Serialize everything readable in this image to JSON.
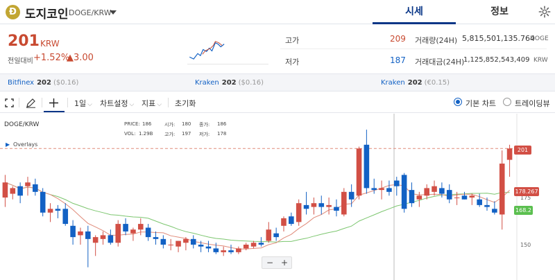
{
  "header": {
    "logo_letter": "Ð",
    "name": "도지코인",
    "code": "DOGE/KRW",
    "tabs": [
      "시세",
      "정보"
    ]
  },
  "summary": {
    "price": "201",
    "unit": "KRW",
    "change_label": "전일대비",
    "change_pct": "+1.52%",
    "change_abs": "▲3.00",
    "high_label": "고가",
    "high_value": "209",
    "low_label": "저가",
    "low_value": "187",
    "volume_label": "거래량(24H)",
    "volume_value": "5,815,501,135.764",
    "volume_unit": "DOGE",
    "amount_label": "거래대금(24H)",
    "amount_value": "1,125,852,543,409",
    "amount_unit": "KRW"
  },
  "exchanges": [
    {
      "name": "Bitfinex",
      "price": "202",
      "conv": "($0.16)"
    },
    {
      "name": "Kraken",
      "price": "202",
      "conv": "($0.16)"
    },
    {
      "name": "Kraken",
      "price": "202",
      "conv": "(€0.15)"
    }
  ],
  "toolbar": {
    "interval": "1일",
    "chart_settings": "차트설정",
    "indicators": "지표",
    "reset": "초기화",
    "basic_chart": "기본 차트",
    "tradingview": "트레이딩뷰"
  },
  "chart": {
    "symbol": "DOGE/KRW",
    "overlays_label": "Overlays",
    "info": {
      "price_label": "PRICE:",
      "price": "186",
      "open_label": "시가:",
      "open": "180",
      "close_label": "종가:",
      "close": "186",
      "vol_label": "VOL:",
      "vol": "1.29B",
      "high_label": "고가:",
      "high": "197",
      "low_label": "저가:",
      "low": "178"
    },
    "price_tag": "201",
    "ma1_tag": "178.267",
    "ma2_tag": "168.2",
    "axis_ticks": [
      "175",
      "150"
    ],
    "zoom_out": "−",
    "zoom_in": "+",
    "colors": {
      "up": "#d24f45",
      "down": "#1261c4",
      "ma_short": "#e08b7a",
      "ma_long": "#7cc66f"
    }
  },
  "chart_data": {
    "type": "candlestick",
    "title": "DOGE/KRW",
    "ylabel": "",
    "y_ticks": [
      175,
      150
    ],
    "candles": [
      {
        "o": 175,
        "h": 187,
        "l": 170,
        "c": 183
      },
      {
        "o": 177,
        "h": 181,
        "l": 174,
        "c": 180
      },
      {
        "o": 181,
        "h": 183,
        "l": 172,
        "c": 176
      },
      {
        "o": 181,
        "h": 186,
        "l": 176,
        "c": 183
      },
      {
        "o": 182,
        "h": 185,
        "l": 176,
        "c": 178
      },
      {
        "o": 178,
        "h": 180,
        "l": 165,
        "c": 167
      },
      {
        "o": 167,
        "h": 172,
        "l": 162,
        "c": 169
      },
      {
        "o": 169,
        "h": 171,
        "l": 164,
        "c": 168
      },
      {
        "o": 169,
        "h": 172,
        "l": 160,
        "c": 161
      },
      {
        "o": 160,
        "h": 163,
        "l": 150,
        "c": 154
      },
      {
        "o": 155,
        "h": 159,
        "l": 150,
        "c": 157
      },
      {
        "o": 157,
        "h": 160,
        "l": 138,
        "c": 153
      },
      {
        "o": 151,
        "h": 155,
        "l": 144,
        "c": 154
      },
      {
        "o": 153,
        "h": 157,
        "l": 150,
        "c": 155
      },
      {
        "o": 155,
        "h": 158,
        "l": 150,
        "c": 151
      },
      {
        "o": 151,
        "h": 163,
        "l": 149,
        "c": 161
      },
      {
        "o": 161,
        "h": 164,
        "l": 155,
        "c": 157
      },
      {
        "o": 156,
        "h": 159,
        "l": 152,
        "c": 158
      },
      {
        "o": 158,
        "h": 164,
        "l": 155,
        "c": 161
      },
      {
        "o": 159,
        "h": 161,
        "l": 152,
        "c": 154
      },
      {
        "o": 154,
        "h": 157,
        "l": 150,
        "c": 153
      },
      {
        "o": 153,
        "h": 155,
        "l": 148,
        "c": 150
      },
      {
        "o": 150,
        "h": 153,
        "l": 147,
        "c": 150
      },
      {
        "o": 149,
        "h": 152,
        "l": 146,
        "c": 152
      },
      {
        "o": 151,
        "h": 154,
        "l": 147,
        "c": 153
      },
      {
        "o": 153,
        "h": 155,
        "l": 148,
        "c": 150
      },
      {
        "o": 150,
        "h": 152,
        "l": 146,
        "c": 149
      },
      {
        "o": 149,
        "h": 152,
        "l": 146,
        "c": 148
      },
      {
        "o": 148,
        "h": 151,
        "l": 145,
        "c": 146
      },
      {
        "o": 146,
        "h": 149,
        "l": 144,
        "c": 147
      },
      {
        "o": 147,
        "h": 150,
        "l": 145,
        "c": 146
      },
      {
        "o": 146,
        "h": 149,
        "l": 145,
        "c": 148
      },
      {
        "o": 148,
        "h": 151,
        "l": 147,
        "c": 150
      },
      {
        "o": 149,
        "h": 152,
        "l": 148,
        "c": 151
      },
      {
        "o": 151,
        "h": 154,
        "l": 149,
        "c": 150
      },
      {
        "o": 152,
        "h": 162,
        "l": 151,
        "c": 158
      },
      {
        "o": 156,
        "h": 159,
        "l": 152,
        "c": 154
      },
      {
        "o": 160,
        "h": 165,
        "l": 157,
        "c": 164
      },
      {
        "o": 165,
        "h": 167,
        "l": 160,
        "c": 161
      },
      {
        "o": 162,
        "h": 174,
        "l": 160,
        "c": 172
      },
      {
        "o": 171,
        "h": 178,
        "l": 166,
        "c": 169
      },
      {
        "o": 170,
        "h": 175,
        "l": 166,
        "c": 172
      },
      {
        "o": 172,
        "h": 176,
        "l": 166,
        "c": 170
      },
      {
        "o": 170,
        "h": 175,
        "l": 166,
        "c": 171
      },
      {
        "o": 170,
        "h": 174,
        "l": 165,
        "c": 168
      },
      {
        "o": 166,
        "h": 180,
        "l": 165,
        "c": 178
      },
      {
        "o": 178,
        "h": 182,
        "l": 170,
        "c": 174
      },
      {
        "o": 176,
        "h": 202,
        "l": 174,
        "c": 201
      },
      {
        "o": 203,
        "h": 211,
        "l": 177,
        "c": 180
      },
      {
        "o": 180,
        "h": 185,
        "l": 177,
        "c": 179
      },
      {
        "o": 179,
        "h": 184,
        "l": 174,
        "c": 180
      },
      {
        "o": 180,
        "h": 184,
        "l": 176,
        "c": 178
      },
      {
        "o": 184,
        "h": 186,
        "l": 176,
        "c": 181
      },
      {
        "o": 187,
        "h": 188,
        "l": 167,
        "c": 169
      },
      {
        "o": 179,
        "h": 183,
        "l": 170,
        "c": 172
      },
      {
        "o": 174,
        "h": 178,
        "l": 170,
        "c": 176
      },
      {
        "o": 176,
        "h": 182,
        "l": 174,
        "c": 180
      },
      {
        "o": 178,
        "h": 184,
        "l": 176,
        "c": 181
      },
      {
        "o": 180,
        "h": 183,
        "l": 175,
        "c": 177
      },
      {
        "o": 179,
        "h": 182,
        "l": 172,
        "c": 174
      },
      {
        "o": 175,
        "h": 178,
        "l": 171,
        "c": 175
      },
      {
        "o": 176,
        "h": 178,
        "l": 174,
        "c": 174
      },
      {
        "o": 175,
        "h": 177,
        "l": 171,
        "c": 176
      },
      {
        "o": 174,
        "h": 177,
        "l": 170,
        "c": 171
      },
      {
        "o": 171,
        "h": 175,
        "l": 168,
        "c": 170
      },
      {
        "o": 169,
        "h": 173,
        "l": 166,
        "c": 167
      },
      {
        "o": 166,
        "h": 200,
        "l": 158,
        "c": 193
      },
      {
        "o": 195,
        "h": 203,
        "l": 186,
        "c": 201
      }
    ],
    "ma_short_last": 178.267,
    "ma_long_last": 168.2,
    "current_price": 201
  }
}
